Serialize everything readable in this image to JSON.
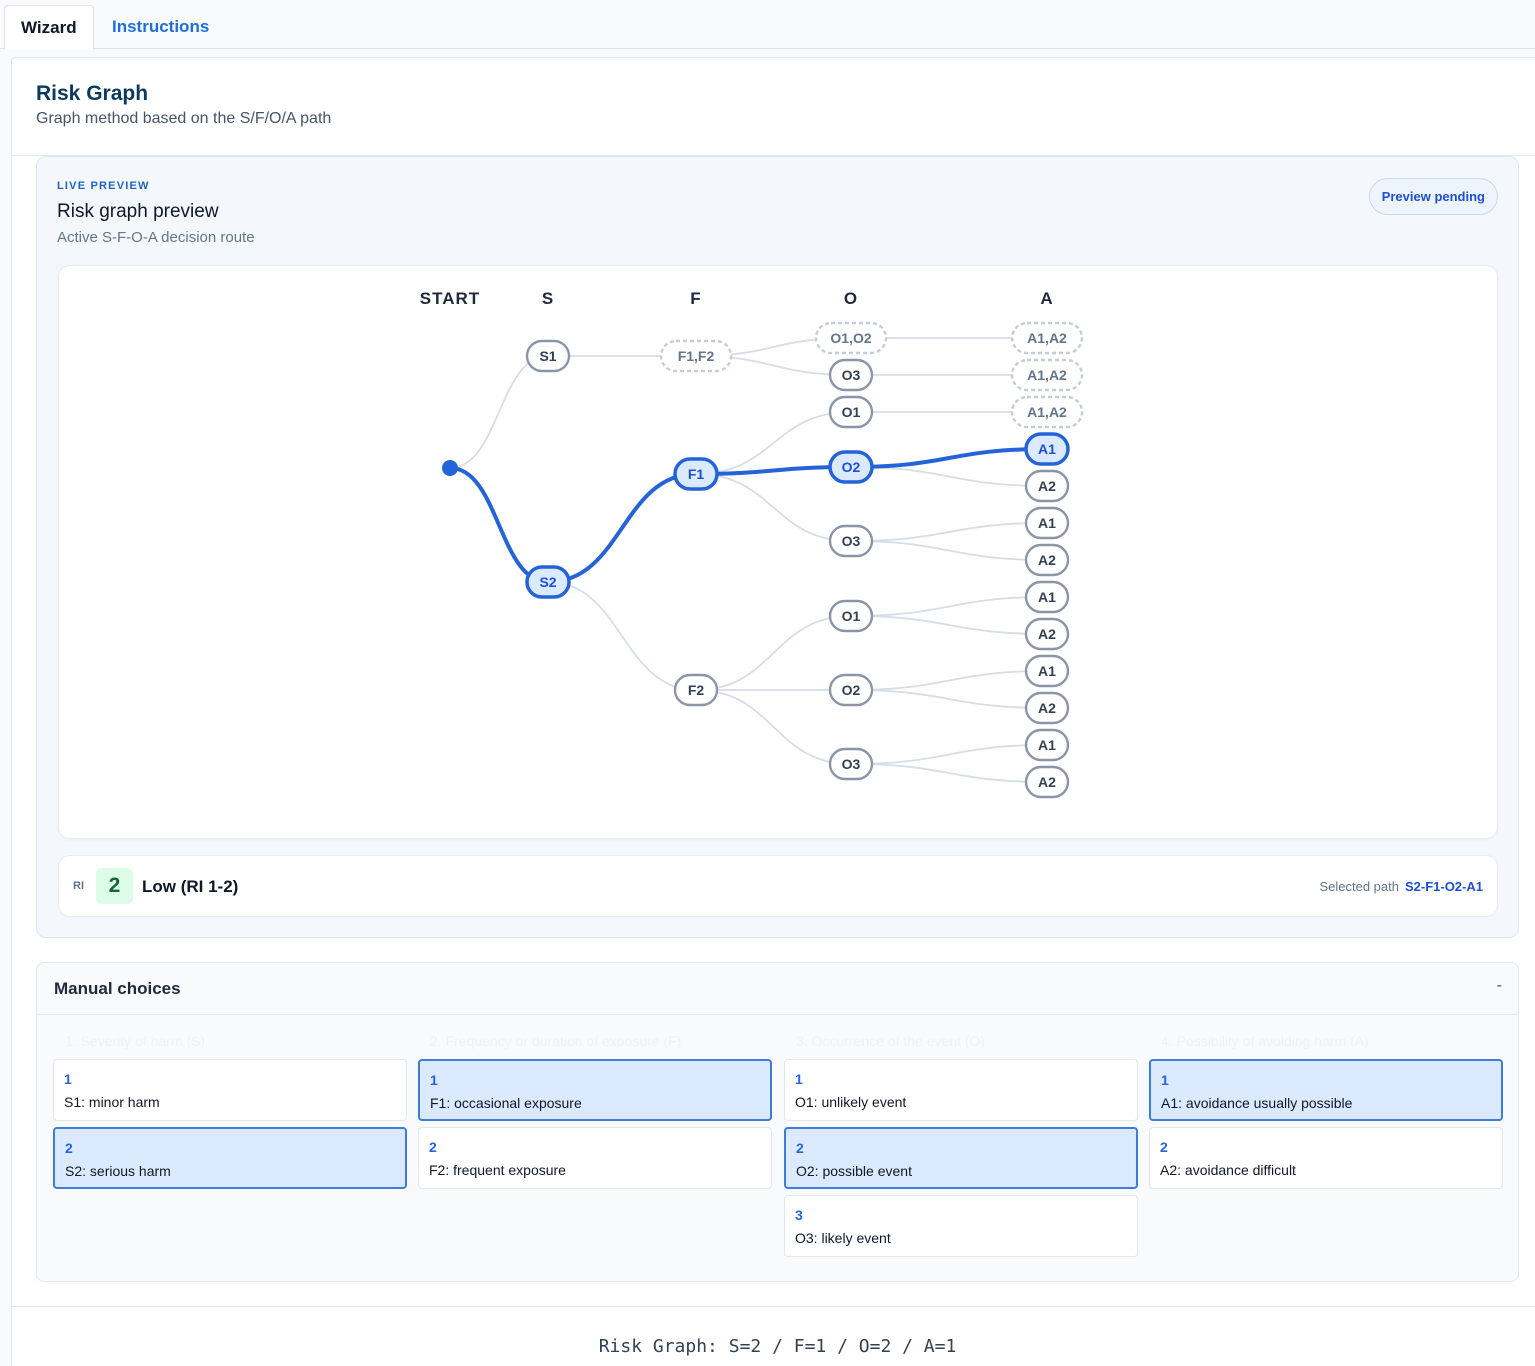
{
  "tabs": [
    {
      "label": "Wizard",
      "active": true
    },
    {
      "label": "Instructions",
      "active": false
    }
  ],
  "header": {
    "title": "Risk Graph",
    "subtitle": "Graph method based on the S/F/O/A path"
  },
  "preview": {
    "eyebrow": "LIVE PREVIEW",
    "title": "Risk graph preview",
    "subtitle": "Active S-F-O-A decision route",
    "status": "Preview pending"
  },
  "graph": {
    "columns": [
      "START",
      "S",
      "F",
      "O",
      "A"
    ],
    "active_path": [
      "S2",
      "F1",
      "O2",
      "A1"
    ],
    "nodes": {
      "s1": "S1",
      "s2": "S2",
      "f_s1": "F1,F2",
      "f1": "F1",
      "f2": "F2",
      "o_s1a": "O1,O2",
      "o_s1b": "O3",
      "o_f1a": "O1",
      "o_f1b": "O2",
      "o_f1c": "O3",
      "o_f2a": "O1",
      "o_f2b": "O2",
      "o_f2c": "O3",
      "a_1": "A1,A2",
      "a_2": "A1,A2",
      "a_3": "A1,A2",
      "a_4": "A1",
      "a_5": "A2",
      "a_6": "A1",
      "a_7": "A2",
      "a_8": "A1",
      "a_9": "A2",
      "a_10": "A1",
      "a_11": "A2",
      "a_12": "A1",
      "a_13": "A2"
    }
  },
  "result": {
    "ri_label": "RI",
    "ri_value": "2",
    "ri_desc": "Low (RI 1-2)",
    "path_label": "Selected path",
    "path_code": "S2-F1-O2-A1"
  },
  "manual": {
    "title": "Manual choices",
    "collapse": "-",
    "columns": [
      {
        "heading": "1. Severity of harm (S)",
        "options": [
          {
            "num": "1",
            "label": "S1: minor harm",
            "selected": false
          },
          {
            "num": "2",
            "label": "S2: serious harm",
            "selected": true
          }
        ]
      },
      {
        "heading": "2. Frequency or duration of exposure (F)",
        "options": [
          {
            "num": "1",
            "label": "F1: occasional exposure",
            "selected": true
          },
          {
            "num": "2",
            "label": "F2: frequent exposure",
            "selected": false
          }
        ]
      },
      {
        "heading": "3. Occurrence of the event (O)",
        "options": [
          {
            "num": "1",
            "label": "O1: unlikely event",
            "selected": false
          },
          {
            "num": "2",
            "label": "O2: possible event",
            "selected": true
          },
          {
            "num": "3",
            "label": "O3: likely event",
            "selected": false
          }
        ]
      },
      {
        "heading": "4. Possibility of avoiding harm (A)",
        "options": [
          {
            "num": "1",
            "label": "A1: avoidance usually possible",
            "selected": true
          },
          {
            "num": "2",
            "label": "A2: avoidance difficult",
            "selected": false
          }
        ]
      }
    ]
  },
  "footer": {
    "formula": "Risk Graph: S=2 / F=1 / O=2 / A=1"
  },
  "colors": {
    "accent": "#2563eb",
    "active_path": "#2563d9",
    "inactive_edge": "#d5dde7",
    "ri_low_bg": "#dcfce7"
  }
}
